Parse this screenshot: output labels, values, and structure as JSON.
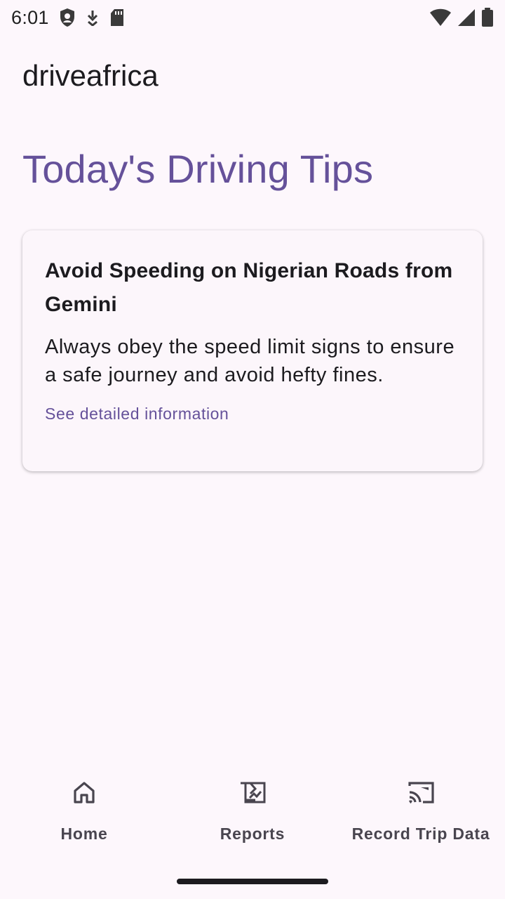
{
  "status_bar": {
    "time": "6:01",
    "left_icons": [
      "shield-icon",
      "download-icon",
      "sd-card-icon"
    ],
    "right_icons": [
      "wifi-icon",
      "cell-signal-icon",
      "battery-icon"
    ]
  },
  "app_bar": {
    "title": "driveafrica"
  },
  "main": {
    "heading": "Today's Driving Tips",
    "tip": {
      "title": "Avoid Speeding on Nigerian Roads from Gemini",
      "body": "Always obey the speed limit signs to ensure a safe journey and avoid hefty fines.",
      "link": "See detailed information"
    }
  },
  "bottom_nav": {
    "items": [
      {
        "label": "Home",
        "icon": "home-icon"
      },
      {
        "label": "Reports",
        "icon": "reports-icon"
      },
      {
        "label": "Record Trip Data",
        "icon": "cast-icon"
      }
    ]
  },
  "colors": {
    "background": "#fdf7fc",
    "accent": "#65519a",
    "card": "#fcf6fb",
    "nav_label": "#49454f"
  }
}
